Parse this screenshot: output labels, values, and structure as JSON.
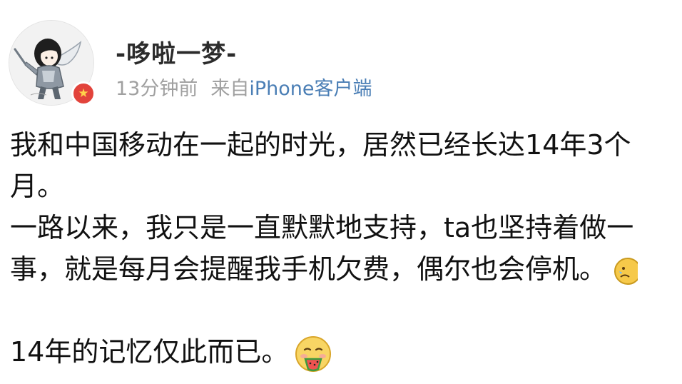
{
  "user": {
    "name": "-哆啦一梦-",
    "time": "13分钟前",
    "source_prefix": "来自",
    "source_link": "iPhone客户端"
  },
  "post": {
    "lines": [
      "我和中国移动在一起的时光，居然已经长达14年3个",
      "月。",
      "一路以来，我只是一直默默地支持，ta也坚持着做一",
      "事，就是每月会提醒我手机欠费，偶尔也会停机。",
      "",
      "14年的记忆仅此而已。"
    ]
  },
  "icons": {
    "avatar": "anime-girl-avatar",
    "badge": "red-star-verified-badge",
    "emoji_cut": "sad-face-emoji",
    "emoji_end": "eating-watermelon-emoji"
  },
  "colors": {
    "link": "#4a7eb5",
    "meta": "#a0a0a0",
    "badge": "#e2433b"
  }
}
